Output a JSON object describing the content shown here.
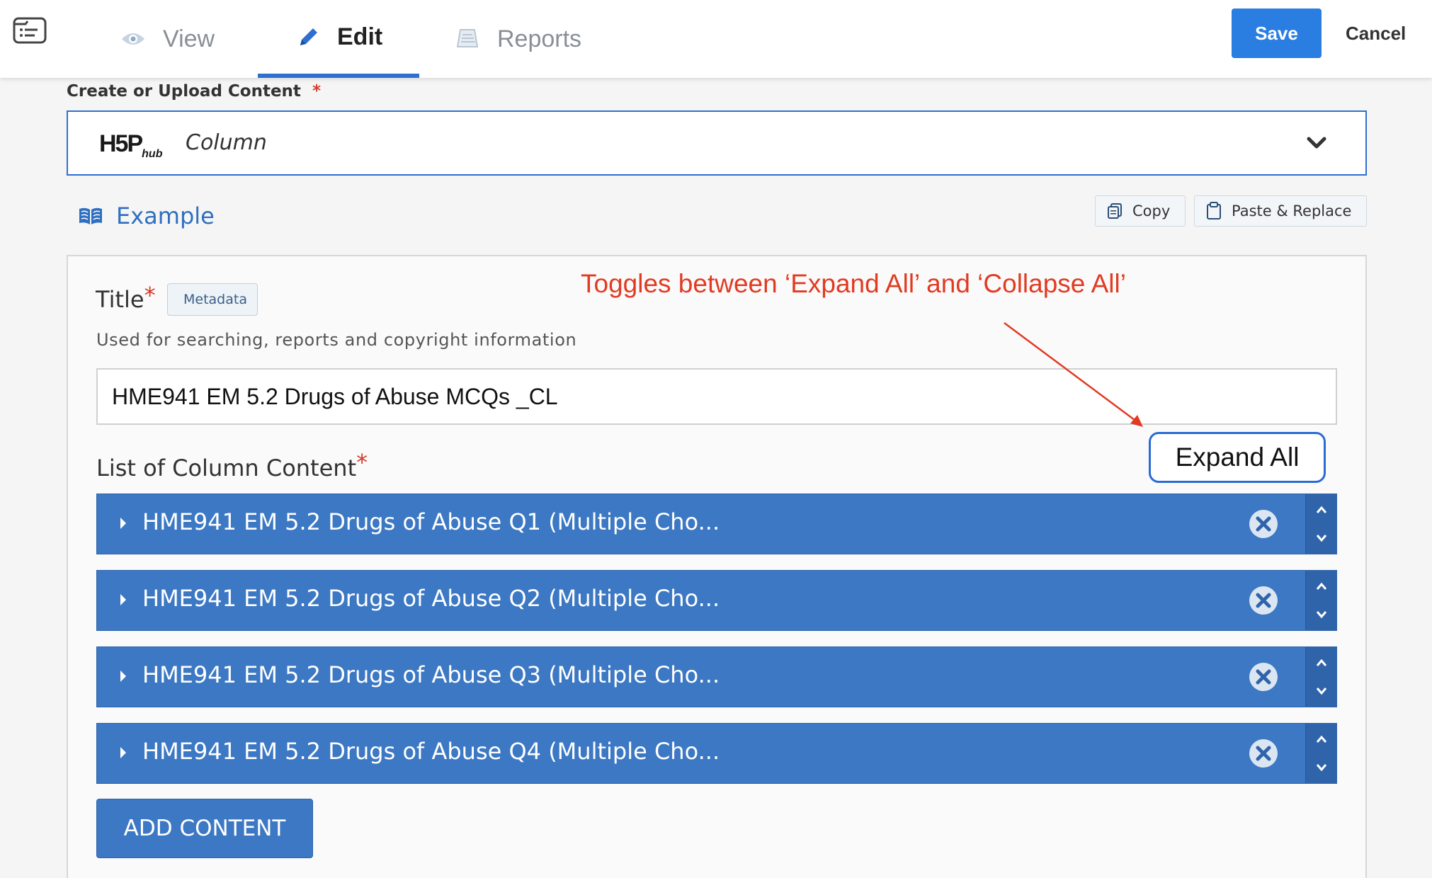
{
  "topbar": {
    "tabs": [
      {
        "label": "View",
        "icon": "eye-icon"
      },
      {
        "label": "Edit",
        "icon": "pencil-icon"
      },
      {
        "label": "Reports",
        "icon": "report-icon"
      }
    ],
    "save_label": "Save",
    "cancel_label": "Cancel"
  },
  "content": {
    "label": "Create or Upload Content",
    "required_mark": "*",
    "selected_type": "Column",
    "logo_text": "H5P",
    "logo_sub": "hub"
  },
  "example_label": "Example",
  "toolbar": {
    "copy_label": "Copy",
    "paste_label": "Paste & Replace"
  },
  "form": {
    "title_label": "Title",
    "required_mark": "*",
    "metadata_label": "Metadata",
    "title_help": "Used for searching, reports and copyright information",
    "title_value": "HME941 EM 5.2 Drugs of Abuse MCQs _CL",
    "list_label": "List of Column Content",
    "expand_all_label": "Expand All",
    "items": [
      {
        "title": "HME941 EM 5.2 Drugs of Abuse Q1 (Multiple Cho..."
      },
      {
        "title": "HME941 EM 5.2 Drugs of Abuse Q2 (Multiple Cho..."
      },
      {
        "title": "HME941 EM 5.2 Drugs of Abuse Q3 (Multiple Cho..."
      },
      {
        "title": "HME941 EM 5.2 Drugs of Abuse Q4 (Multiple Cho..."
      }
    ],
    "add_content_label": "ADD CONTENT"
  },
  "annotation": {
    "text": "Toggles between ‘Expand All’ and ‘Collapse All’"
  },
  "colors": {
    "accent": "#2a7de1",
    "item_bar": "#3c78c3",
    "annotation": "#e13b22",
    "required": "#d43c2a"
  }
}
